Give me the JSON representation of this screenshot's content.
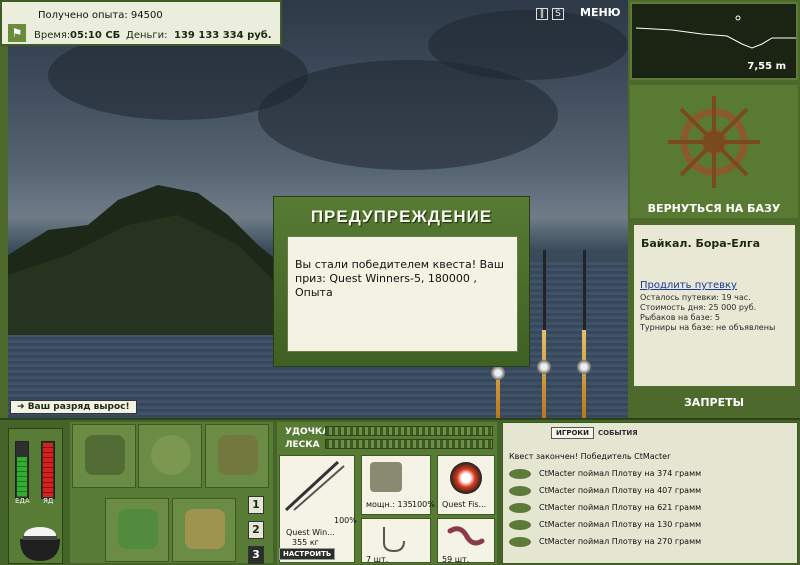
{
  "status": {
    "xp_text": "Получено опыта: 94500",
    "time_label": "Время:",
    "time_value": "05:10 СБ",
    "money_label": "Деньги:",
    "money_value": "139 133 334 руб."
  },
  "top_menu": {
    "pause_icon": "pause-icon",
    "sound_icon": "sound-icon",
    "menu_label": "МЕНЮ"
  },
  "rank_message": "Ваш разряд вырос!",
  "dialog": {
    "title": "ПРЕДУПРЕЖДЕНИЕ",
    "message": "Вы стали победителем квеста! Ваш приз: Quest Winners-5, 180000 , Опыта"
  },
  "depth": {
    "value": "7,55 m"
  },
  "right_panel": {
    "return_label": "ВЕРНУТЬСЯ НА БАЗУ",
    "location": "Байкал. Бора-Елга",
    "extend_link": "Продлить путевку",
    "lines": [
      "Осталось путевки: 19 час.",
      "Стоимость дня: 25 000 руб.",
      "Рыбаков на базе: 5",
      "Турниры на базе: не объявлены"
    ],
    "bans_label": "ЗАПРЕТЫ"
  },
  "meters": {
    "food_label": "ЕДА",
    "poison_label": "ЯД",
    "food_level": 0.72,
    "poison_level": 0.97
  },
  "inventory_tabs": [
    "1",
    "2",
    "3"
  ],
  "tackle": {
    "rod_label": "УДОЧКА",
    "line_label": "ЛЕСКА",
    "rod_name": "Quest Win...",
    "rod_weight": "355 кг",
    "rod_percent": "100%",
    "reel_power": "мощн.: 135",
    "reel_percent": "100%",
    "line_name": "Quest Fis...",
    "hook_count": "7 шт.",
    "bait_count": "59 шт.",
    "tune_label": "НАСТРОИТЬ"
  },
  "events": {
    "tabs": [
      "ИГРОКИ",
      "СОБЫТИЯ"
    ],
    "items": [
      "Квест закончен! Победитель CtMacter",
      "CtMacter поймал Плотву на 374 грамм",
      "CtMacter поймал Плотву на 407 грамм",
      "CtMacter поймал Плотву на 621 грамм",
      "CtMacter поймал Плотву на 130 грамм",
      "CtMacter поймал Плотву на 270 грамм"
    ]
  },
  "colors": {
    "panel_green": "#4d6a2c",
    "accent_light": "#eceedd",
    "food_green": "#2fae2f",
    "poison_red": "#d82020"
  }
}
